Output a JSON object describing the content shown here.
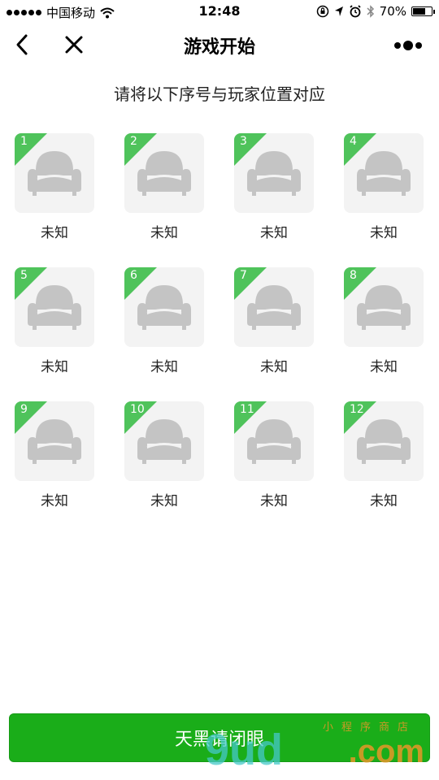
{
  "status_bar": {
    "carrier": "中国移动",
    "time": "12:48",
    "battery": "70%",
    "battery_level": 0.7
  },
  "nav": {
    "title": "游戏开始"
  },
  "instruction": "请将以下序号与玩家位置对应",
  "seats": [
    {
      "number": "1",
      "label": "未知"
    },
    {
      "number": "2",
      "label": "未知"
    },
    {
      "number": "3",
      "label": "未知"
    },
    {
      "number": "4",
      "label": "未知"
    },
    {
      "number": "5",
      "label": "未知"
    },
    {
      "number": "6",
      "label": "未知"
    },
    {
      "number": "7",
      "label": "未知"
    },
    {
      "number": "8",
      "label": "未知"
    },
    {
      "number": "9",
      "label": "未知"
    },
    {
      "number": "10",
      "label": "未知"
    },
    {
      "number": "11",
      "label": "未知"
    },
    {
      "number": "12",
      "label": "未知"
    }
  ],
  "bottom_button": {
    "label": "天黑请闭眼"
  },
  "watermark": {
    "main": "9ud",
    "suffix": ".com",
    "sub": "小程序商店"
  },
  "colors": {
    "accent_green": "#1aad19",
    "badge_green": "#4fc35b",
    "seat_bg": "#f3f3f3",
    "sofa_gray": "#c4c4c4"
  }
}
